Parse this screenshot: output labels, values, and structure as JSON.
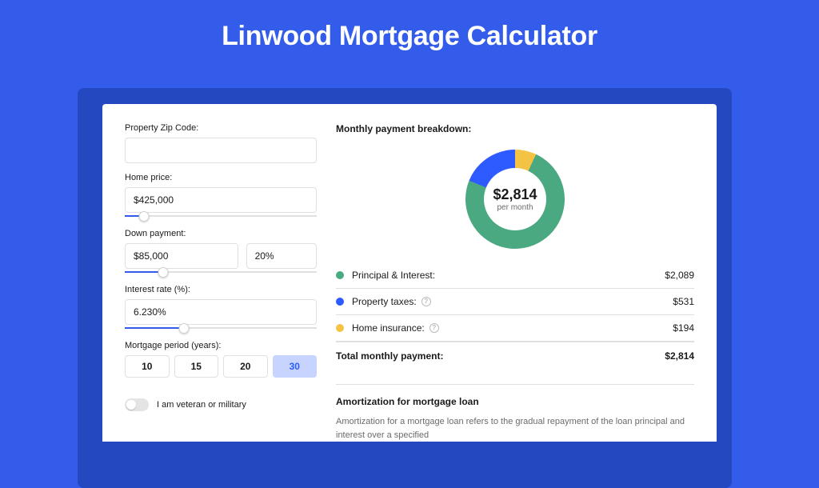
{
  "page_title": "Linwood Mortgage Calculator",
  "colors": {
    "background": "#335CEB",
    "donut_green": "#4BA981",
    "donut_blue": "#2D5BFF",
    "donut_yellow": "#F5C344"
  },
  "form": {
    "zip": {
      "label": "Property Zip Code:",
      "value": ""
    },
    "home_price": {
      "label": "Home price:",
      "value": "$425,000",
      "slider_pct": 10
    },
    "down_payment": {
      "label": "Down payment:",
      "value": "$85,000",
      "percent": "20%",
      "slider_pct": 20
    },
    "interest_rate": {
      "label": "Interest rate (%):",
      "value": "6.230%",
      "slider_pct": 31
    },
    "mortgage_period": {
      "label": "Mortgage period (years):",
      "options": [
        "10",
        "15",
        "20",
        "30"
      ],
      "selected": "30"
    },
    "veteran": {
      "label": "I am veteran or military",
      "checked": false
    }
  },
  "breakdown": {
    "title": "Monthly payment breakdown:",
    "center_value": "$2,814",
    "center_sub": "per month",
    "items": [
      {
        "label": "Principal & Interest:",
        "value": "$2,089",
        "color": "#4BA981",
        "info": false
      },
      {
        "label": "Property taxes:",
        "value": "$531",
        "color": "#2D5BFF",
        "info": true
      },
      {
        "label": "Home insurance:",
        "value": "$194",
        "color": "#F5C344",
        "info": true
      }
    ],
    "total_label": "Total monthly payment:",
    "total_value": "$2,814"
  },
  "amort": {
    "title": "Amortization for mortgage loan",
    "text": "Amortization for a mortgage loan refers to the gradual repayment of the loan principal and interest over a specified"
  },
  "chart_data": {
    "type": "pie",
    "title": "Monthly payment breakdown",
    "series": [
      {
        "name": "Principal & Interest",
        "value": 2089,
        "color": "#4BA981"
      },
      {
        "name": "Property taxes",
        "value": 531,
        "color": "#2D5BFF"
      },
      {
        "name": "Home insurance",
        "value": 194,
        "color": "#F5C344"
      }
    ],
    "total": 2814,
    "unit": "USD per month"
  }
}
